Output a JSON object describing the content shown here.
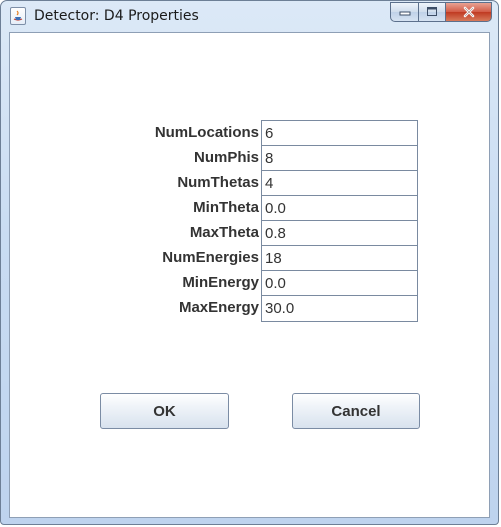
{
  "window": {
    "title": "Detector: D4 Properties",
    "icon": "java-app-icon",
    "caption_buttons": [
      "minimize-icon",
      "maximize-icon",
      "close-icon"
    ]
  },
  "form": {
    "fields": [
      {
        "label": "NumLocations",
        "value": "6"
      },
      {
        "label": "NumPhis",
        "value": "8"
      },
      {
        "label": "NumThetas",
        "value": "4"
      },
      {
        "label": "MinTheta",
        "value": "0.0"
      },
      {
        "label": "MaxTheta",
        "value": "0.8"
      },
      {
        "label": "NumEnergies",
        "value": "18"
      },
      {
        "label": "MinEnergy",
        "value": "0.0"
      },
      {
        "label": "MaxEnergy",
        "value": "30.0"
      }
    ]
  },
  "buttons": {
    "ok_label": "OK",
    "cancel_label": "Cancel"
  },
  "colors": {
    "title_bar": "#c9dcf2",
    "close_button": "#c03a22",
    "text": "#333333"
  }
}
